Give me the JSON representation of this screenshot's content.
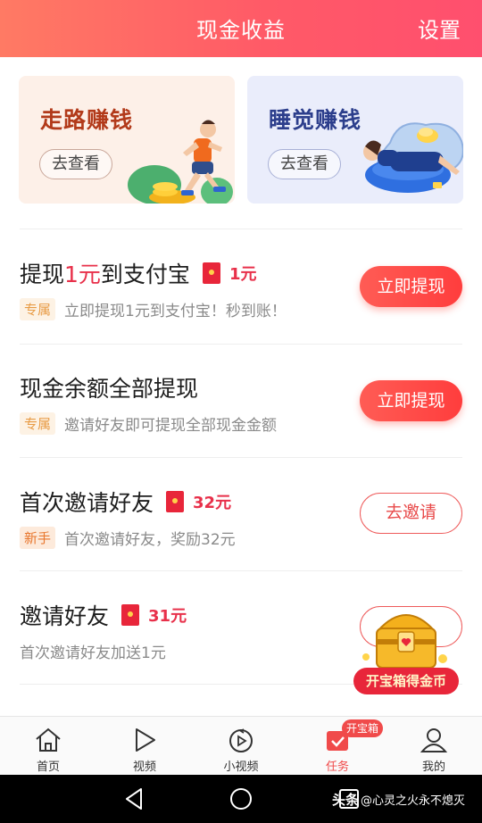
{
  "header": {
    "title": "现金收益",
    "settings": "设置"
  },
  "promos": [
    {
      "title": "走路赚钱",
      "button": "去查看"
    },
    {
      "title": "睡觉赚钱",
      "button": "去查看"
    }
  ],
  "tasks": [
    {
      "name_pre": "提现",
      "name_hl": "1元",
      "name_post": "到支付宝",
      "reward": "1元",
      "tag": "专属",
      "desc": "立即提现1元到支付宝！秒到账！",
      "button": "立即提现"
    },
    {
      "name": "现金余额全部提现",
      "tag": "专属",
      "desc": "邀请好友即可提现全部现金金额",
      "button": "立即提现"
    },
    {
      "name": "首次邀请好友",
      "reward": "32元",
      "tag": "新手",
      "desc": "首次邀请好友，奖励32元",
      "button": "去邀请"
    },
    {
      "name": "邀请好友",
      "reward": "31元",
      "desc": "首次邀请好友加送1元"
    }
  ],
  "chest": {
    "label": "开宝箱得金币"
  },
  "nav": {
    "items": [
      {
        "label": "首页",
        "icon": "home-icon"
      },
      {
        "label": "视频",
        "icon": "play-icon"
      },
      {
        "label": "小视频",
        "icon": "short-video-icon"
      },
      {
        "label": "任务",
        "icon": "task-icon",
        "active": true
      },
      {
        "label": "我的",
        "icon": "profile-icon"
      }
    ],
    "badge": "开宝箱"
  },
  "watermark": {
    "brand": "头条",
    "handle": "@心灵之火永不熄灭"
  },
  "colors": {
    "accent": "#ff5a67",
    "reward_red": "#e8304a",
    "header_start": "#ff7a64",
    "header_end": "#ff4f6e"
  }
}
